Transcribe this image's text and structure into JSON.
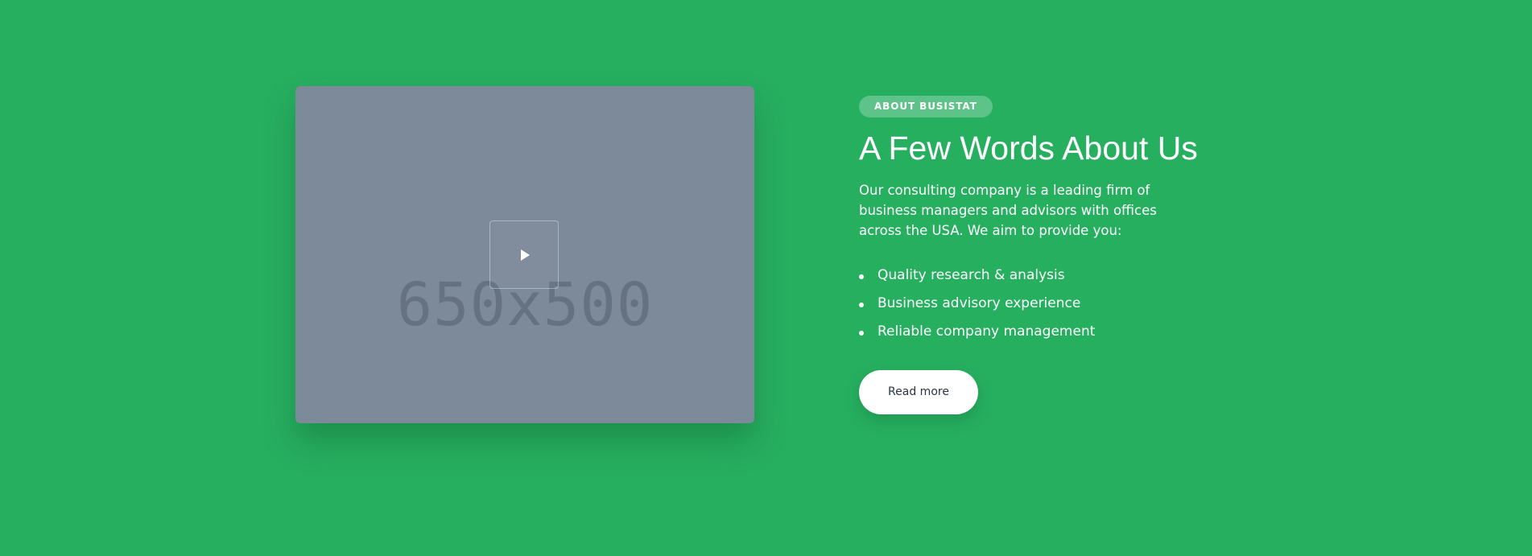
{
  "media": {
    "placeholder_text": "650x500",
    "play_icon": "play-icon"
  },
  "about": {
    "badge": "ABOUT BUSISTAT",
    "heading": "A Few Words About Us",
    "intro": "Our consulting company is a leading firm of business managers and advisors with offices across the USA. We aim to provide you:",
    "features": [
      {
        "label": "Quality research & analysis"
      },
      {
        "label": "Business advisory experience"
      },
      {
        "label": "Reliable company management"
      }
    ],
    "button_label": "Read more"
  },
  "colors": {
    "background": "#27af60",
    "placeholder_bg": "#7d8a99",
    "button_text": "#2a3542"
  }
}
